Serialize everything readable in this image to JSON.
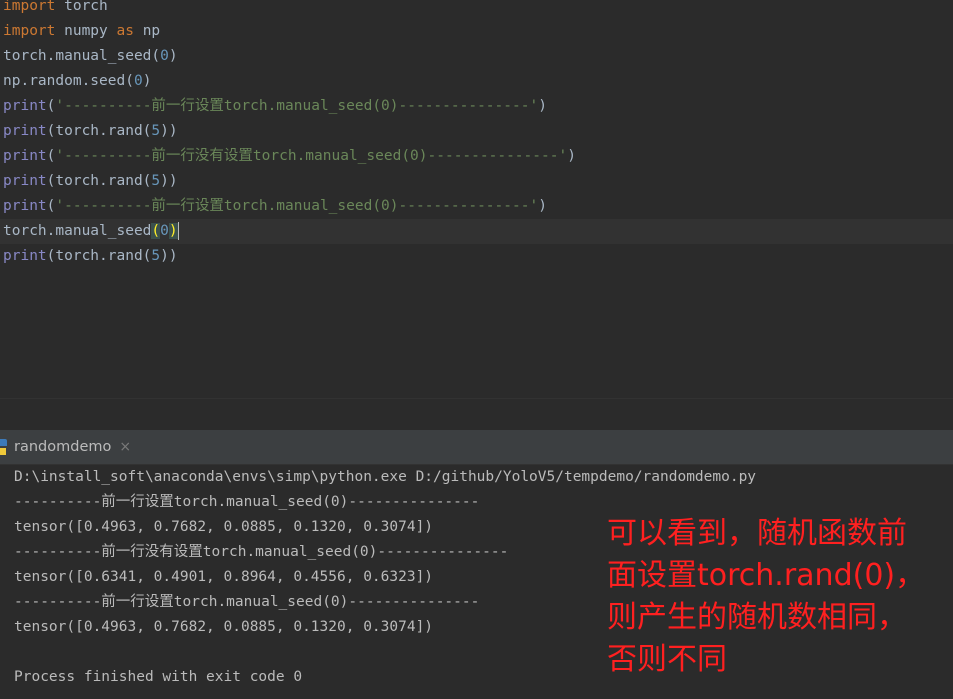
{
  "editor": {
    "lines": [
      {
        "tokens": [
          {
            "c": "kw",
            "t": "import"
          },
          {
            "c": "plain",
            "t": " torch"
          }
        ]
      },
      {
        "tokens": [
          {
            "c": "kw",
            "t": "import"
          },
          {
            "c": "plain",
            "t": " numpy "
          },
          {
            "c": "kw",
            "t": "as"
          },
          {
            "c": "plain",
            "t": " np"
          }
        ]
      },
      {
        "tokens": [
          {
            "c": "plain",
            "t": "torch.manual_seed("
          },
          {
            "c": "num",
            "t": "0"
          },
          {
            "c": "plain",
            "t": ")"
          }
        ]
      },
      {
        "tokens": [
          {
            "c": "plain",
            "t": "np.random.seed("
          },
          {
            "c": "num",
            "t": "0"
          },
          {
            "c": "plain",
            "t": ")"
          }
        ]
      },
      {
        "tokens": [
          {
            "c": "fn",
            "t": "print"
          },
          {
            "c": "plain",
            "t": "("
          },
          {
            "c": "str",
            "t": "'----------前一行设置torch.manual_seed(0)---------------'"
          },
          {
            "c": "plain",
            "t": ")"
          }
        ]
      },
      {
        "tokens": [
          {
            "c": "fn",
            "t": "print"
          },
          {
            "c": "plain",
            "t": "(torch.rand("
          },
          {
            "c": "num",
            "t": "5"
          },
          {
            "c": "plain",
            "t": "))"
          }
        ]
      },
      {
        "tokens": [
          {
            "c": "fn",
            "t": "print"
          },
          {
            "c": "plain",
            "t": "("
          },
          {
            "c": "str",
            "t": "'----------前一行没有设置torch.manual_seed(0)---------------'"
          },
          {
            "c": "plain",
            "t": ")"
          }
        ]
      },
      {
        "tokens": [
          {
            "c": "fn",
            "t": "print"
          },
          {
            "c": "plain",
            "t": "(torch.rand("
          },
          {
            "c": "num",
            "t": "5"
          },
          {
            "c": "plain",
            "t": "))"
          }
        ]
      },
      {
        "tokens": [
          {
            "c": "fn",
            "t": "print"
          },
          {
            "c": "plain",
            "t": "("
          },
          {
            "c": "str",
            "t": "'----------前一行设置torch.manual_seed(0)---------------'"
          },
          {
            "c": "plain",
            "t": ")"
          }
        ]
      },
      {
        "tokens": [
          {
            "c": "plain",
            "t": "torch.manual_seed"
          },
          {
            "c": "paren-hl",
            "t": "("
          },
          {
            "c": "num",
            "t": "0"
          },
          {
            "c": "paren-hl",
            "t": ")"
          }
        ],
        "current": true
      },
      {
        "tokens": [
          {
            "c": "fn",
            "t": "print"
          },
          {
            "c": "plain",
            "t": "(torch.rand("
          },
          {
            "c": "num",
            "t": "5"
          },
          {
            "c": "plain",
            "t": "))"
          }
        ]
      }
    ]
  },
  "run_panel": {
    "tab_label": "randomdemo",
    "close_glyph": "×"
  },
  "console": {
    "lines": [
      "D:\\install_soft\\anaconda\\envs\\simp\\python.exe D:/github/YoloV5/tempdemo/randomdemo.py",
      "----------前一行设置torch.manual_seed(0)---------------",
      "tensor([0.4963, 0.7682, 0.0885, 0.1320, 0.3074])",
      "----------前一行没有设置torch.manual_seed(0)---------------",
      "tensor([0.6341, 0.4901, 0.8964, 0.4556, 0.6323])",
      "----------前一行设置torch.manual_seed(0)---------------",
      "tensor([0.4963, 0.7682, 0.0885, 0.1320, 0.3074])",
      "",
      "Process finished with exit code 0"
    ]
  },
  "annotation": {
    "lines": [
      "可以看到，随机函数前",
      "面设置torch.rand(0)，",
      "则产生的随机数相同，",
      "否则不同"
    ],
    "color": "#ff2020"
  }
}
